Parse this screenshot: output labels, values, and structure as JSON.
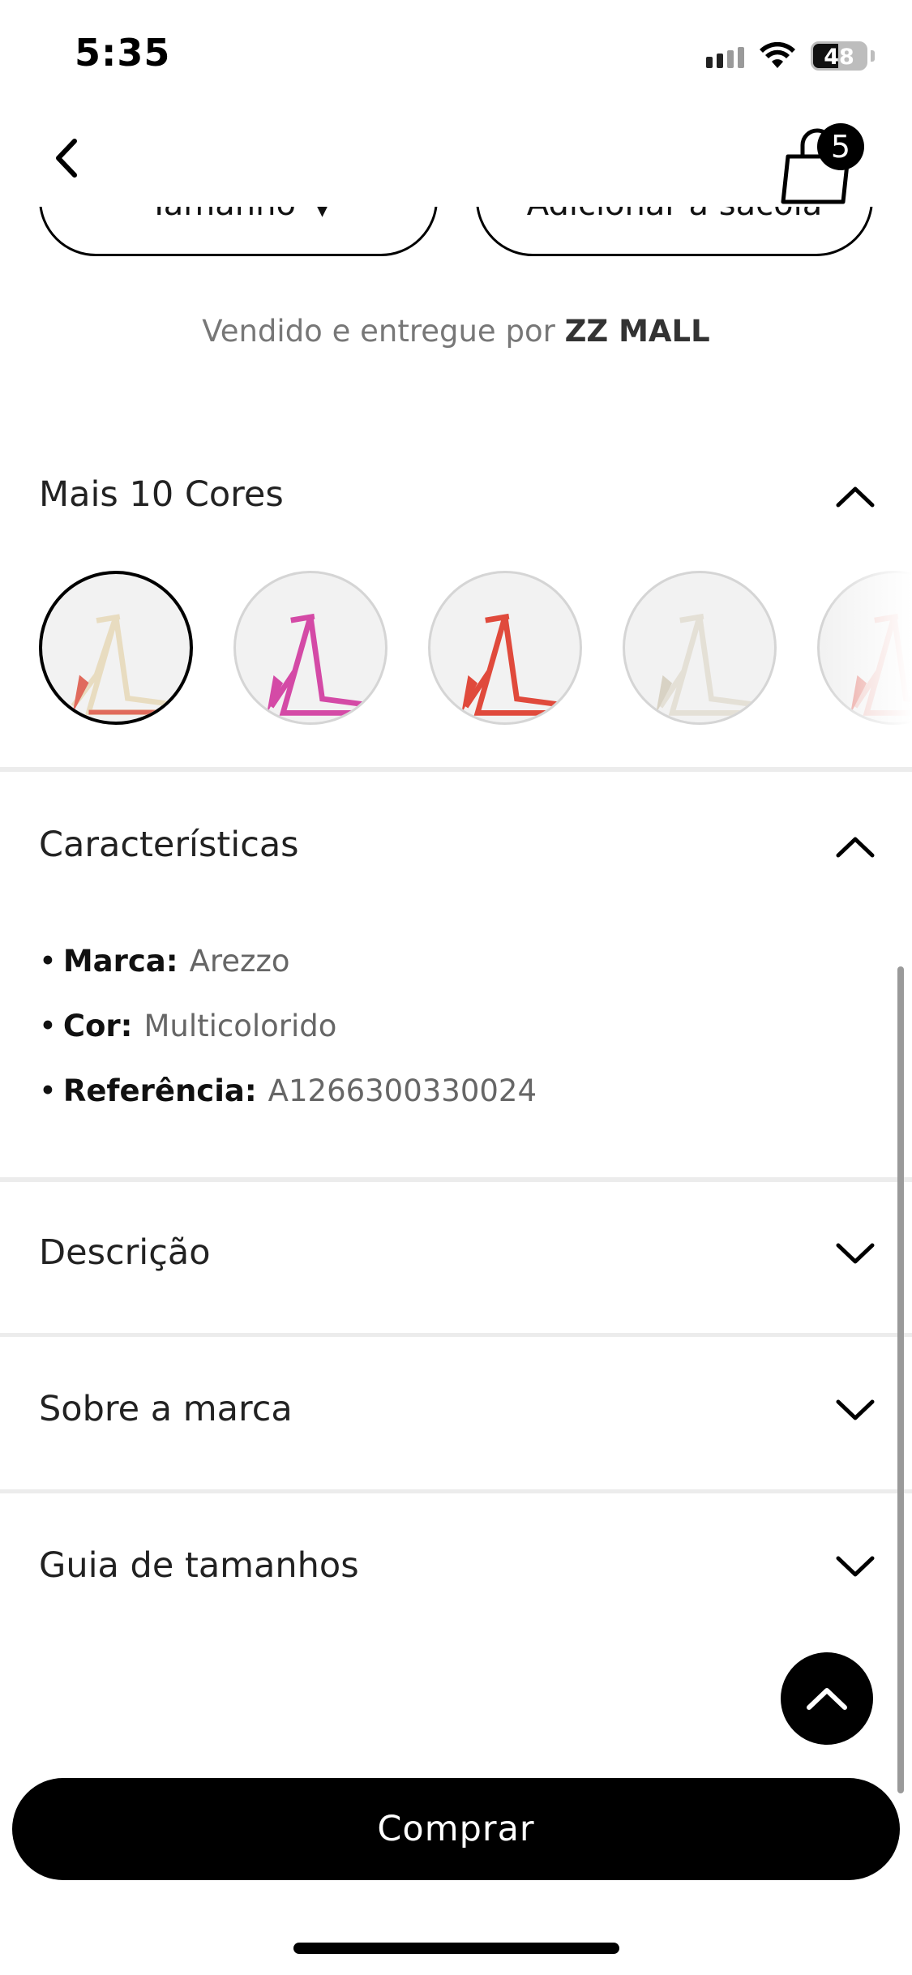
{
  "status_bar": {
    "time": "5:35",
    "battery": "48",
    "icons": [
      "signal-icon",
      "wifi-icon",
      "battery-icon"
    ]
  },
  "header": {
    "back_icon": "chevron-left-icon",
    "bag_icon": "shopping-bag-icon",
    "bag_count": "5"
  },
  "actions": {
    "size_label": "Tamanho",
    "add_to_bag_label": "Adicionar à sacola"
  },
  "sold_by": {
    "prefix": "Vendido e entregue por",
    "seller": "ZZ MALL"
  },
  "colors_section": {
    "title": "Mais 10 Cores",
    "expanded": true,
    "swatches": [
      {
        "name": "nude-vermelho",
        "color": "#e8dcc0",
        "accent": "#e06a5c"
      },
      {
        "name": "pink",
        "color": "#d44aa6",
        "accent": "#d44aa6"
      },
      {
        "name": "red",
        "color": "#e04a3c",
        "accent": "#e04a3c"
      },
      {
        "name": "off-white",
        "color": "#e4e0d6",
        "accent": "#d8d2c4"
      },
      {
        "name": "nude-rose",
        "color": "#f0ccc8",
        "accent": "#e89a94"
      }
    ]
  },
  "characteristics": {
    "title": "Características",
    "expanded": true,
    "items": [
      {
        "label": "Marca:",
        "value": "Arezzo"
      },
      {
        "label": "Cor:",
        "value": "Multicolorido"
      },
      {
        "label": "Referência:",
        "value": "A1266300330024"
      }
    ]
  },
  "sections": [
    {
      "title": "Descrição",
      "expanded": false
    },
    {
      "title": "Sobre a marca",
      "expanded": false
    },
    {
      "title": "Guia de tamanhos",
      "expanded": false
    }
  ],
  "buy_button": {
    "label": "Comprar"
  },
  "colors": {
    "primary": "#000000",
    "divider": "#ececec",
    "muted_text": "#666666"
  }
}
